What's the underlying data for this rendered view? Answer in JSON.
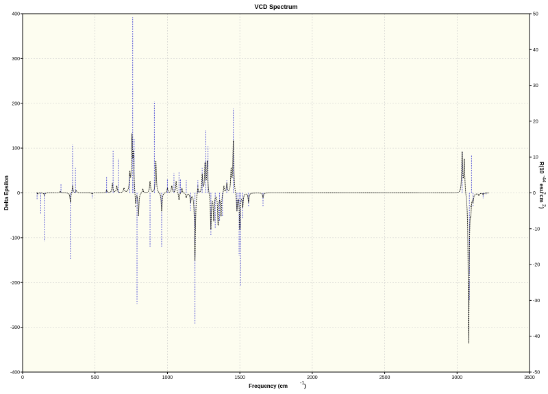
{
  "chart_data": {
    "type": "line",
    "title": "VCD Spectrum",
    "xlabel": "Frequency (cm",
    "xlabel_superscript": "-1",
    "xlabel_suffix": ")",
    "ylabel_left": "Delta Epsilon",
    "ylabel_right_parts": [
      "R(10",
      "-44",
      "esu",
      "2",
      "cm",
      "2",
      ")"
    ],
    "xlim": [
      0,
      3500
    ],
    "ylim_left": [
      -400,
      400
    ],
    "ylim_right": [
      -50,
      50
    ],
    "x_ticks": [
      "0",
      "500",
      "1000",
      "1500",
      "2000",
      "2500",
      "3000",
      "3500"
    ],
    "y_left_ticks": [
      "-400",
      "-300",
      "-200",
      "-100",
      "0",
      "100",
      "200",
      "300",
      "400"
    ],
    "y_right_ticks": [
      "-50",
      "-40",
      "-30",
      "-20",
      "-10",
      "0",
      "10",
      "20",
      "30",
      "40",
      "50"
    ],
    "grid": true,
    "colors": {
      "plot_background": "#fdfdf0",
      "spectrum": "#111111",
      "sticks": "#5b5bd6",
      "grid": "#c8c8c8"
    },
    "series": [
      {
        "kind": "spectrum",
        "axis": "left",
        "x": [
          100,
          105,
          150,
          260,
          330,
          345,
          370,
          480,
          580,
          620,
          650,
          700,
          740,
          755,
          765,
          780,
          800,
          830,
          880,
          920,
          960,
          1000,
          1030,
          1060,
          1080,
          1100,
          1130,
          1160,
          1190,
          1210,
          1240,
          1260,
          1275,
          1300,
          1320,
          1350,
          1370,
          1390,
          1410,
          1440,
          1455,
          1480,
          1500,
          1520,
          1560,
          1660,
          3035,
          3050,
          3080,
          3095,
          3110,
          3150,
          3180,
          3200
        ],
        "values": [
          0,
          -2,
          -5,
          3,
          -20,
          15,
          5,
          -2,
          5,
          20,
          15,
          10,
          40,
          120,
          80,
          -30,
          -50,
          8,
          25,
          70,
          -40,
          10,
          15,
          25,
          -15,
          10,
          -10,
          -20,
          -150,
          15,
          40,
          65,
          70,
          -80,
          -60,
          -70,
          -50,
          15,
          20,
          50,
          115,
          -40,
          -80,
          -30,
          -20,
          -10,
          90,
          75,
          -335,
          -30,
          -15,
          -5,
          -3,
          0
        ]
      },
      {
        "kind": "rotational-strength-sticks",
        "axis": "right",
        "x": [
          100,
          125,
          150,
          265,
          330,
          345,
          365,
          480,
          580,
          625,
          660,
          740,
          760,
          770,
          790,
          880,
          910,
          960,
          1000,
          1045,
          1080,
          1090,
          1130,
          1160,
          1190,
          1210,
          1240,
          1265,
          1280,
          1300,
          1330,
          1360,
          1380,
          1410,
          1455,
          1480,
          1495,
          1505,
          1520,
          1560,
          1660,
          3035,
          3085,
          3100,
          3110,
          3180,
          3200
        ],
        "values": [
          -2,
          -6,
          -13.5,
          2.5,
          -18.5,
          13.5,
          7,
          -1.5,
          4.5,
          12,
          9.5,
          5,
          49,
          15,
          -31,
          -15,
          25.5,
          -15,
          4,
          5.5,
          6,
          4,
          3.5,
          -5,
          -36.5,
          3.5,
          7,
          17.5,
          13,
          -12,
          -10,
          -8,
          -6.5,
          3.5,
          23.5,
          -5,
          -17.5,
          -26,
          -7,
          -4,
          -4,
          11.5,
          -30,
          10.5,
          -4,
          -1.5,
          -0.5
        ]
      }
    ]
  }
}
